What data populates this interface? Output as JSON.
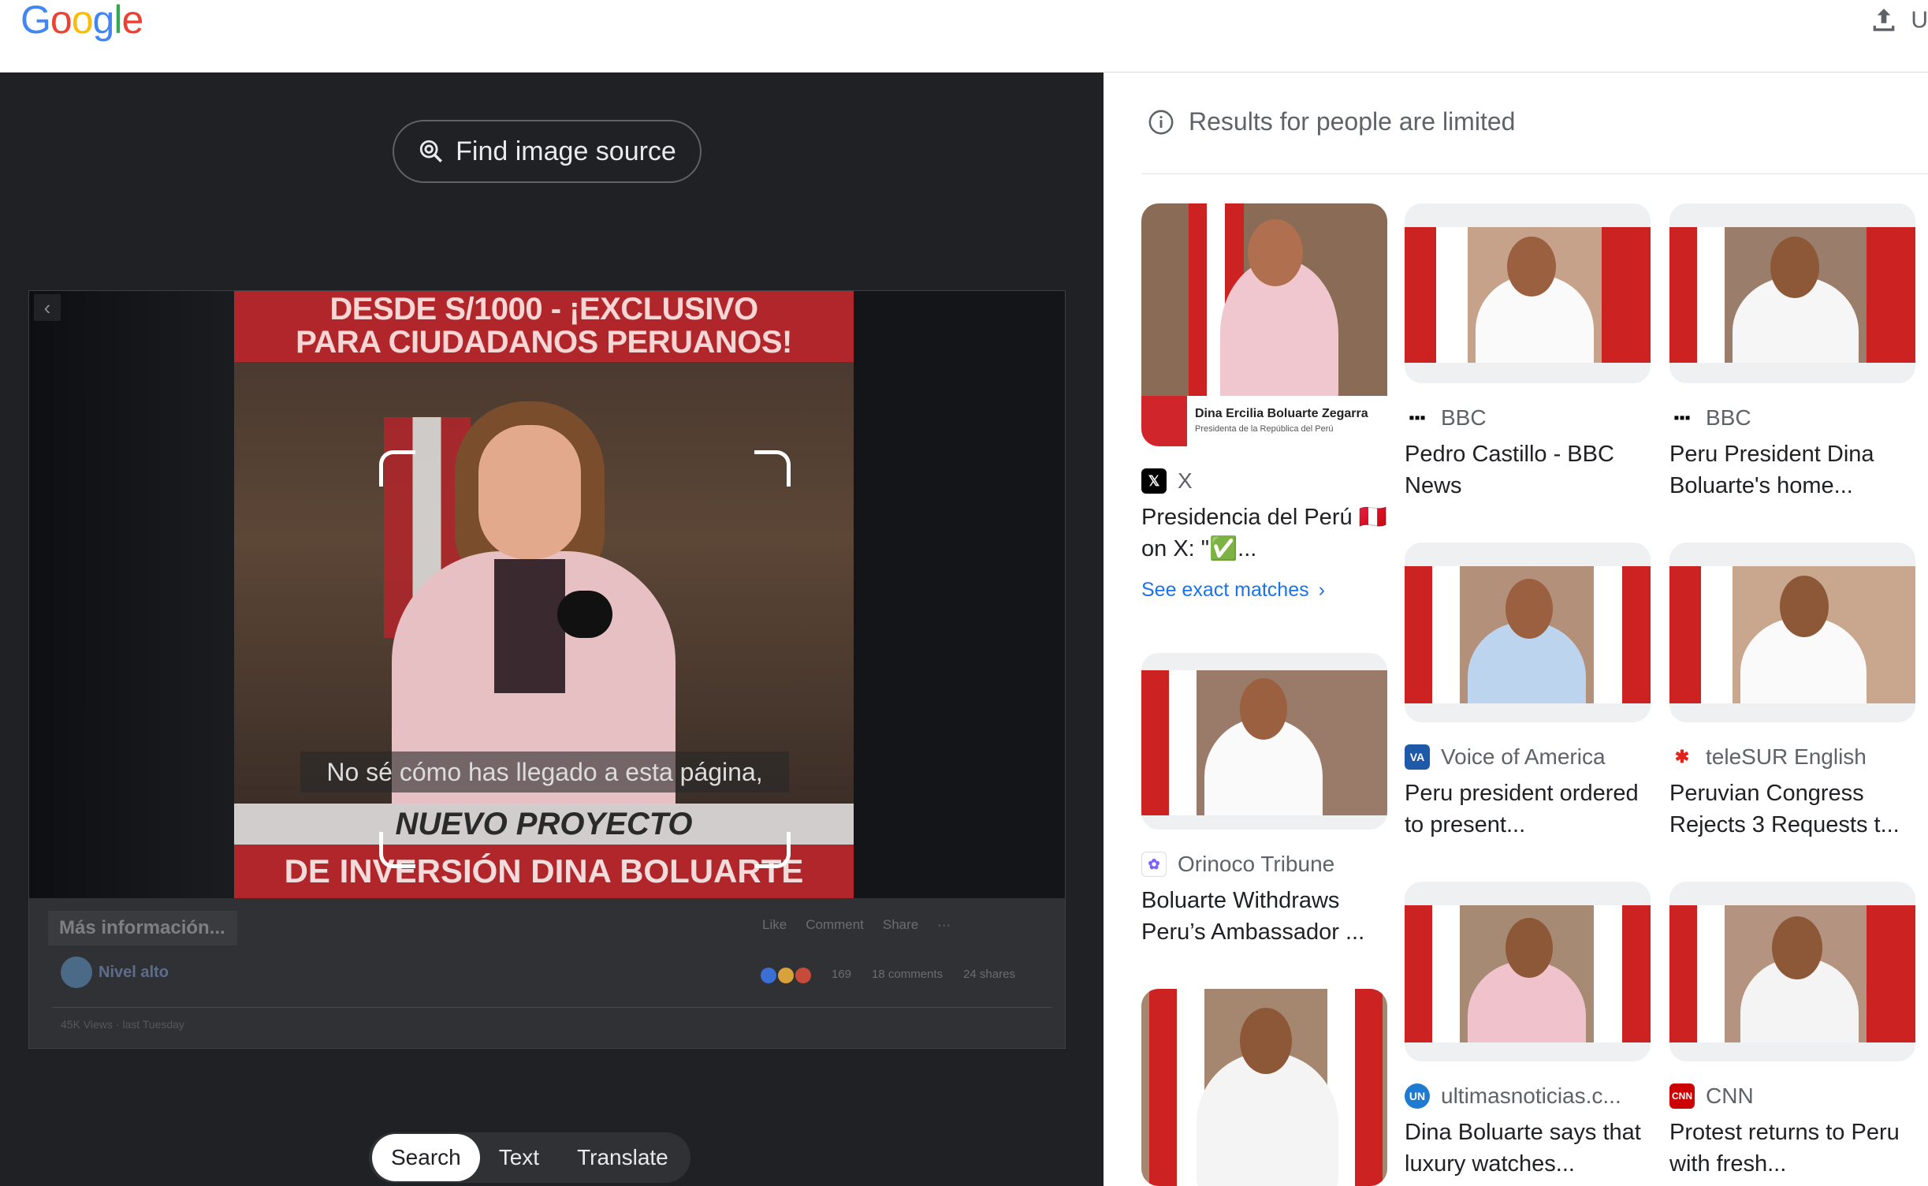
{
  "header": {
    "logo": "Google",
    "upload_label": "U"
  },
  "left_panel": {
    "find_source_label": "Find image source",
    "video": {
      "banner_top_line1": "DESDE S/1000 - ¡EXCLUSIVO",
      "banner_top_line2": "PARA CIUDADANOS PERUANOS!",
      "subtitle": "No sé cómo has llegado a esta página,",
      "banner_mid": "NUEVO PROYECTO",
      "banner_bottom": "DE INVERSIÓN DINA BOLUARTE"
    },
    "post": {
      "more_info": "Más información...",
      "like": "Like",
      "comment": "Comment",
      "share": "Share",
      "user": "Nivel alto",
      "reactions": "169",
      "comments": "18 comments",
      "shares": "24 shares",
      "views": "45K Views · last Tuesday"
    },
    "tabs": [
      {
        "label": "Search",
        "active": true
      },
      {
        "label": "Text",
        "active": false
      },
      {
        "label": "Translate",
        "active": false
      }
    ]
  },
  "right_panel": {
    "notice": "Results for people are limited",
    "results": [
      {
        "source": "X",
        "title": "Presidencia del Perú 🇵🇪 on X: \"✅...",
        "favicon": "x-icon",
        "caption_name": "Dina Ercilia Boluarte Zegarra",
        "caption_role": "Presidenta de la República del Perú",
        "exact_matches": "See exact matches"
      },
      {
        "source": "BBC",
        "title": "Pedro Castillo - BBC News",
        "favicon": "bbc-icon"
      },
      {
        "source": "BBC",
        "title": "Peru President Dina Boluarte's home...",
        "favicon": "bbc-icon"
      },
      {
        "source": "Voice of America",
        "title": "Peru president ordered to present...",
        "favicon": "voa-icon"
      },
      {
        "source": "teleSUR English",
        "title": "Peruvian Congress Rejects 3 Requests t...",
        "favicon": "telesur-icon"
      },
      {
        "source": "Orinoco Tribune",
        "title": "Boluarte Withdraws Peru’s Ambassador ...",
        "favicon": "orinoco-icon"
      },
      {
        "source": "ultimasnoticias.c...",
        "title": "Dina Boluarte says that luxury watches...",
        "favicon": "un-icon"
      },
      {
        "source": "CNN",
        "title": "Protest returns to Peru with fresh...",
        "favicon": "cnn-icon"
      }
    ]
  },
  "colors": {
    "accent": "#1a73e8",
    "dark_bg": "#202124",
    "banner_red": "#b1262a"
  }
}
